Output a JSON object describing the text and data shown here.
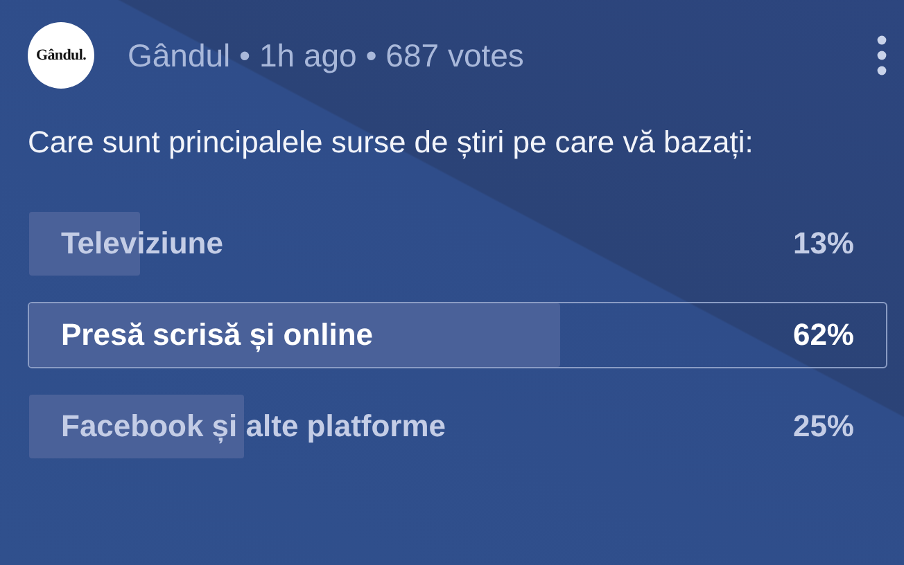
{
  "post": {
    "logo": "Gândul.",
    "meta": "Gândul • 1h ago • 687 votes",
    "question": "Care sunt principalele surse de știri pe care vă bazați:"
  },
  "options": [
    {
      "label": "Televiziune",
      "percent": "13%",
      "level": 0.13,
      "selected": false
    },
    {
      "label": "Presă scrisă și online",
      "percent": "62%",
      "level": 0.62,
      "selected": true
    },
    {
      "label": "Facebook și alte platforme",
      "percent": "25%",
      "level": 0.25,
      "selected": false
    }
  ]
}
